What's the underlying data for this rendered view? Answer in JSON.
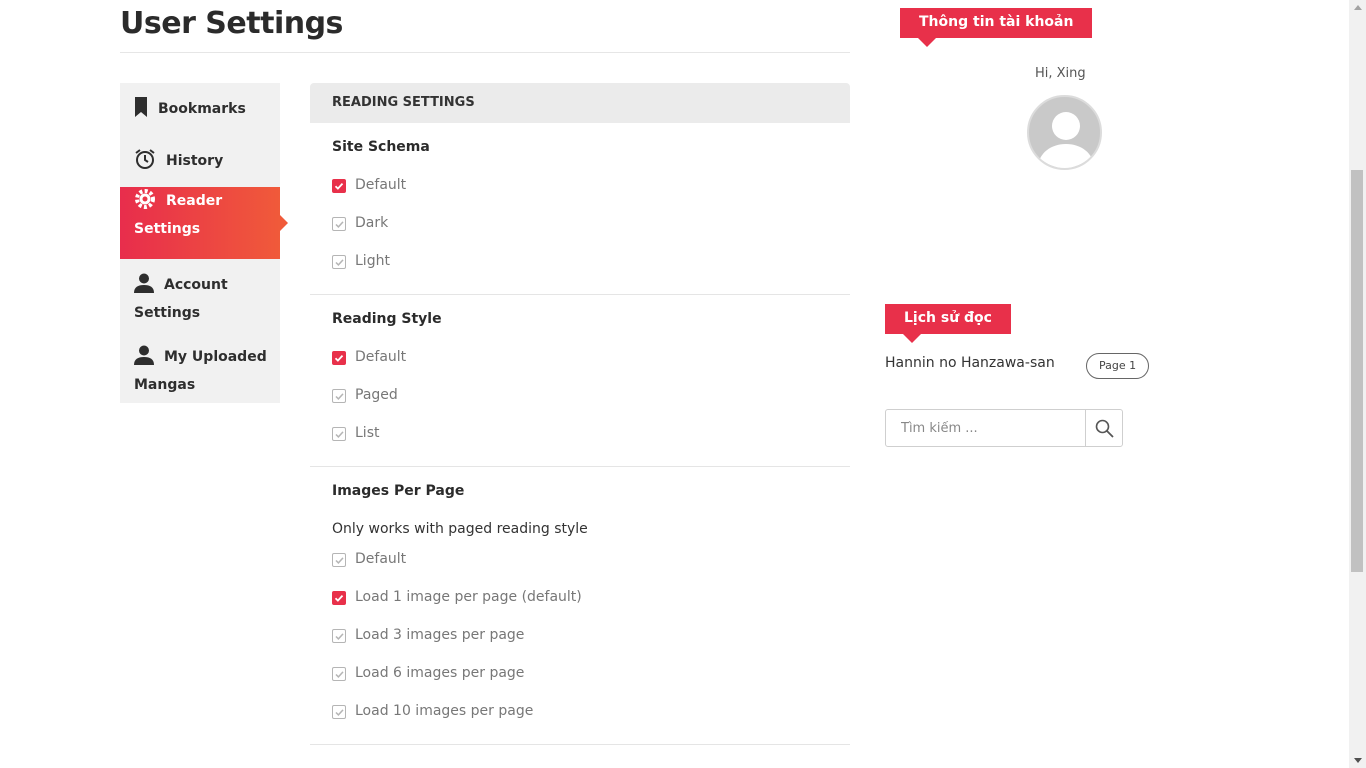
{
  "page": {
    "title": "User Settings"
  },
  "sidebar": {
    "items": [
      {
        "label": "Bookmarks",
        "icon": "bookmark-icon"
      },
      {
        "label": "History",
        "icon": "alarm-clock-icon"
      },
      {
        "label": "Reader Settings",
        "icon": "gear-icon",
        "active": true
      },
      {
        "label": "Account Settings",
        "icon": "user-icon"
      },
      {
        "label": "My Uploaded Mangas",
        "icon": "user-icon"
      }
    ]
  },
  "panel": {
    "header": "READING SETTINGS",
    "sections": [
      {
        "title": "Site Schema",
        "options": [
          {
            "label": "Default",
            "checked": true
          },
          {
            "label": "Dark",
            "checked": false
          },
          {
            "label": "Light",
            "checked": false
          }
        ]
      },
      {
        "title": "Reading Style",
        "options": [
          {
            "label": "Default",
            "checked": true
          },
          {
            "label": "Paged",
            "checked": false
          },
          {
            "label": "List",
            "checked": false
          }
        ]
      },
      {
        "title": "Images Per Page",
        "note": "Only works with paged reading style",
        "options": [
          {
            "label": "Default",
            "checked": false
          },
          {
            "label": "Load 1 image per page (default)",
            "checked": true
          },
          {
            "label": "Load 3 images per page",
            "checked": false
          },
          {
            "label": "Load 6 images per page",
            "checked": false
          },
          {
            "label": "Load 10 images per page",
            "checked": false
          }
        ]
      }
    ]
  },
  "account": {
    "ribbon": "Thông tin tài khoản",
    "greeting": "Hi, Xing"
  },
  "history": {
    "ribbon": "Lịch sử đọc",
    "manga_title": "Hannin no Hanzawa-san",
    "page_label": "Page 1"
  },
  "search": {
    "placeholder": "Tìm kiếm ..."
  },
  "colors": {
    "accent": "#e8304a",
    "accent_end": "#f05a3a",
    "sidebar_bg": "#f1f1f1",
    "panel_header_bg": "#ebebeb"
  }
}
